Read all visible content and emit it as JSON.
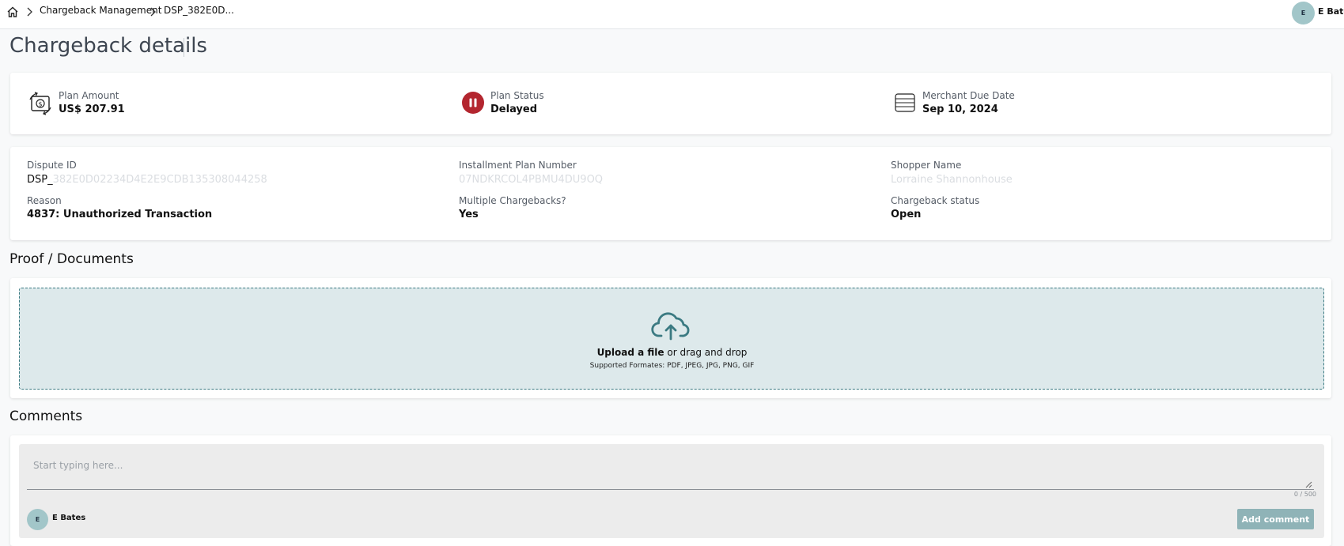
{
  "breadcrumb": {
    "home_icon": "home-icon",
    "items": [
      "Chargeback Management",
      "DSP_382E0D..."
    ]
  },
  "user": {
    "initial": "E",
    "name": "E Bates"
  },
  "page": {
    "title": "Chargeback details"
  },
  "summary": {
    "plan_amount": {
      "icon": "money-cycle-icon",
      "label": "Plan Amount",
      "value": "US$ 207.91"
    },
    "plan_status": {
      "icon": "pause-icon",
      "label": "Plan Status",
      "value": "Delayed",
      "color": "#b3262f"
    },
    "merchant_due_date": {
      "icon": "calendar-lines-icon",
      "label": "Merchant Due Date",
      "value": "Sep 10, 2024"
    }
  },
  "details": {
    "dispute_id": {
      "label": "Dispute ID",
      "value_visible": "DSP_",
      "value_redacted": "382E0D02234D4E2E9CDB135308044258"
    },
    "installment_plan_number": {
      "label": "Installment Plan Number",
      "value": "07NDKRCOL4PBMU4DU9OQ"
    },
    "shopper_name": {
      "label": "Shopper Name",
      "value": "Lorraine Shannonhouse"
    },
    "reason": {
      "label": "Reason",
      "value": "4837: Unauthorized Transaction"
    },
    "multiple_chargebacks": {
      "label": "Multiple Chargebacks?",
      "value": "Yes"
    },
    "chargeback_status": {
      "label": "Chargeback status",
      "value": "Open"
    }
  },
  "proof": {
    "title": "Proof / Documents",
    "upload_icon": "cloud-upload-icon",
    "upload_strong": "Upload a file",
    "upload_rest": " or drag and drop",
    "formats": "Supported Formates: PDF, JPEG, JPG, PNG, GIF"
  },
  "comments": {
    "title": "Comments",
    "placeholder": "Start typing here...",
    "char_count": "0 / 500",
    "add_button": "Add comment"
  },
  "colors": {
    "accent": "#3b7a82",
    "dropzone_bg": "#dde9eb",
    "button": "#8fb3b7",
    "avatar": "#a2c6c9"
  }
}
